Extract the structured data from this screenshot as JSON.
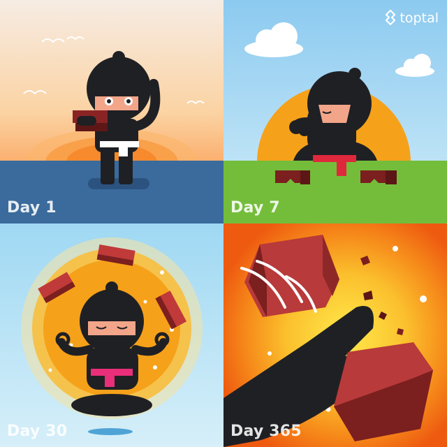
{
  "panels": [
    {
      "label": "Day 1"
    },
    {
      "label": "Day 7"
    },
    {
      "label": "Day 30"
    },
    {
      "label": "Day 365"
    }
  ],
  "brand": {
    "name": "toptal"
  },
  "colors": {
    "ninja": "#1f2024",
    "brick": "#7b1f1f",
    "sea": "#3a6b9c",
    "grass": "#74bd3b",
    "sun": "#f6a11a",
    "belt_white": "#ffffff",
    "belt_red": "#e0283c",
    "belt_pink": "#ea2f7a"
  }
}
